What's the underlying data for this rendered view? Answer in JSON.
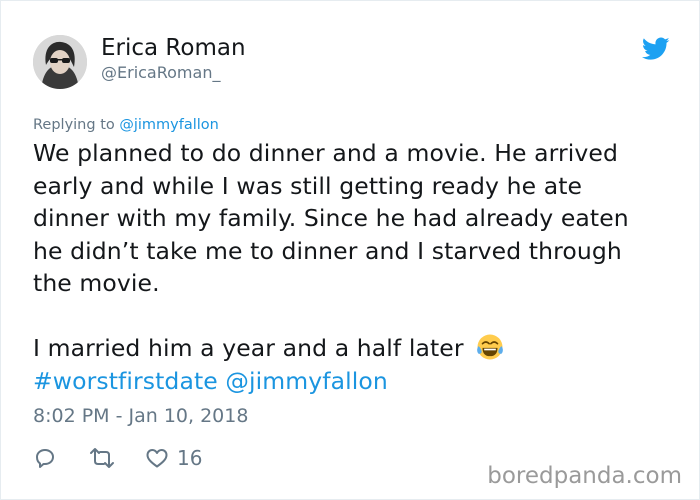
{
  "author": {
    "name": "Erica Roman",
    "handle": "@EricaRoman_",
    "avatar_icon": "profile-photo"
  },
  "platform_icon": "twitter-bird-icon",
  "replying": {
    "prefix": "Replying to ",
    "target": "@jimmyfallon"
  },
  "tweet": {
    "paragraph1": "We planned to do dinner and a movie. He arrived early and while I was still getting ready he ate dinner with my family. Since he had already eaten he didn’t take me to dinner and I starved through the movie.",
    "paragraph2": "I married him a year and a half later",
    "emoji_icon": "tears-of-joy-emoji-icon",
    "hashtag": "#worstfirstdate",
    "mention": "@jimmyfallon"
  },
  "timestamp": "8:02 PM - Jan 10, 2018",
  "actions": {
    "reply_icon": "reply-icon",
    "retweet_icon": "retweet-icon",
    "like_icon": "heart-icon",
    "like_count": "16"
  },
  "watermark": "boredpanda.com",
  "colors": {
    "link": "#1b95e0",
    "secondary_text": "#657786",
    "primary_text": "#14171a",
    "twitter_blue": "#1da1f2"
  }
}
